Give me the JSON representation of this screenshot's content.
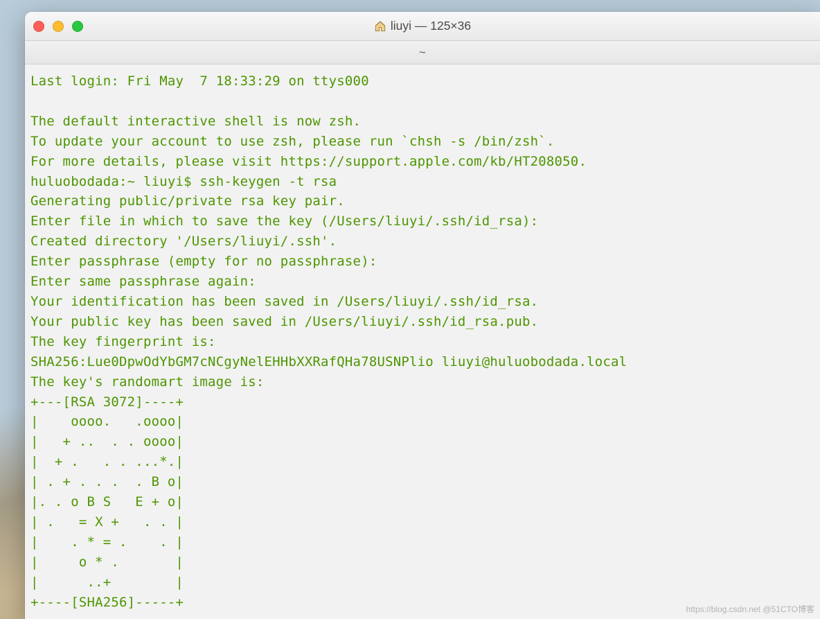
{
  "window": {
    "title": "liuyi — 125×36",
    "tab_label": "~"
  },
  "terminal": {
    "lines": [
      "Last login: Fri May  7 18:33:29 on ttys000",
      "",
      "The default interactive shell is now zsh.",
      "To update your account to use zsh, please run `chsh -s /bin/zsh`.",
      "For more details, please visit https://support.apple.com/kb/HT208050.",
      "huluobodada:~ liuyi$ ssh-keygen -t rsa",
      "Generating public/private rsa key pair.",
      "Enter file in which to save the key (/Users/liuyi/.ssh/id_rsa):",
      "Created directory '/Users/liuyi/.ssh'.",
      "Enter passphrase (empty for no passphrase):",
      "Enter same passphrase again:",
      "Your identification has been saved in /Users/liuyi/.ssh/id_rsa.",
      "Your public key has been saved in /Users/liuyi/.ssh/id_rsa.pub.",
      "The key fingerprint is:",
      "SHA256:Lue0DpwOdYbGM7cNCgyNelEHHbXXRafQHa78USNPlio liuyi@huluobodada.local",
      "The key's randomart image is:",
      "+---[RSA 3072]----+",
      "|    oooo.   .oooo|",
      "|   + ..  . . oooo|",
      "|  + .   . . ...*.|",
      "| . + . . .  . B o|",
      "|. . o B S   E + o|",
      "| .   = X +   . . |",
      "|    . * = .    . |",
      "|     o * .       |",
      "|      ..+        |",
      "+----[SHA256]-----+"
    ]
  },
  "watermark": "https://blog.csdn.net @51CTO博客"
}
